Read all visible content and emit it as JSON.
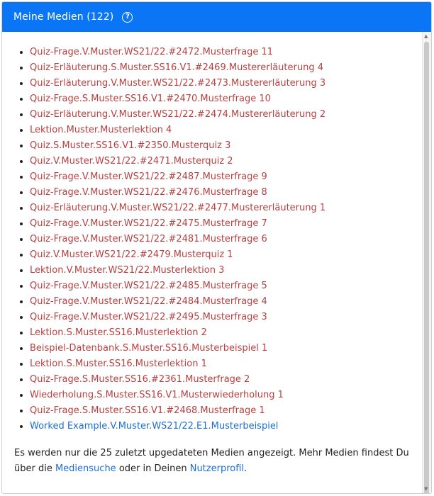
{
  "header": {
    "title": "Meine Medien (122)",
    "help_icon": "question-circle-icon"
  },
  "colors": {
    "header_bg": "#0a76f6",
    "link_red": "#b9403f",
    "link_blue": "#1a6fd8"
  },
  "media_items": [
    {
      "label": "Quiz-Frage.V.Muster.WS21/22.#2472.Musterfrage 11",
      "color": "red"
    },
    {
      "label": "Quiz-Erläuterung.S.Muster.SS16.V1.#2469.Mustererläuterung 4",
      "color": "red"
    },
    {
      "label": "Quiz-Erläuterung.V.Muster.WS21/22.#2473.Mustererläuterung 3",
      "color": "red"
    },
    {
      "label": "Quiz-Frage.S.Muster.SS16.V1.#2470.Musterfrage 10",
      "color": "red"
    },
    {
      "label": "Quiz-Erläuterung.V.Muster.WS21/22.#2474.Mustererläuterung 2",
      "color": "red"
    },
    {
      "label": "Lektion.Muster.Musterlektion 4",
      "color": "red"
    },
    {
      "label": "Quiz.S.Muster.SS16.V1.#2350.Musterquiz 3",
      "color": "red"
    },
    {
      "label": "Quiz.V.Muster.WS21/22.#2471.Musterquiz 2",
      "color": "red"
    },
    {
      "label": "Quiz-Frage.V.Muster.WS21/22.#2487.Musterfrage 9",
      "color": "red"
    },
    {
      "label": "Quiz-Frage.V.Muster.WS21/22.#2476.Musterfrage 8",
      "color": "red"
    },
    {
      "label": "Quiz-Erläuterung.V.Muster.WS21/22.#2477.Mustererläuterung 1",
      "color": "red"
    },
    {
      "label": "Quiz-Frage.V.Muster.WS21/22.#2475.Musterfrage 7",
      "color": "red"
    },
    {
      "label": "Quiz-Frage.V.Muster.WS21/22.#2481.Musterfrage 6",
      "color": "red"
    },
    {
      "label": "Quiz.V.Muster.WS21/22.#2479.Musterquiz 1",
      "color": "red"
    },
    {
      "label": "Lektion.V.Muster.WS21/22.Musterlektion 3",
      "color": "red"
    },
    {
      "label": "Quiz-Frage.V.Muster.WS21/22.#2485.Musterfrage 5",
      "color": "red"
    },
    {
      "label": "Quiz-Frage.V.Muster.WS21/22.#2484.Musterfrage 4",
      "color": "red"
    },
    {
      "label": "Quiz-Frage.V.Muster.WS21/22.#2495.Musterfrage 3",
      "color": "red"
    },
    {
      "label": "Lektion.S.Muster.SS16.Musterlektion 2",
      "color": "red"
    },
    {
      "label": "Beispiel-Datenbank.S.Muster.SS16.Musterbeispiel 1",
      "color": "red"
    },
    {
      "label": "Lektion.S.Muster.SS16.Musterlektion 1",
      "color": "red"
    },
    {
      "label": "Quiz-Frage.S.Muster.SS16.#2361.Musterfrage 2",
      "color": "red"
    },
    {
      "label": "Wiederholung.S.Muster.SS16.V1.Musterwiederholung 1",
      "color": "red"
    },
    {
      "label": "Quiz-Frage.S.Muster.SS16.V1.#2468.Musterfrage 1",
      "color": "red"
    },
    {
      "label": "Worked Example.V.Muster.WS21/22.E1.Musterbeispiel",
      "color": "blue"
    }
  ],
  "footer": {
    "text_1": "Es werden nur die 25 zuletzt upgedateten Medien angezeigt. Mehr Medien findest Du über die ",
    "link_search": "Mediensuche",
    "text_2": " oder in Deinen ",
    "link_profile": "Nutzerprofil",
    "text_3": "."
  }
}
